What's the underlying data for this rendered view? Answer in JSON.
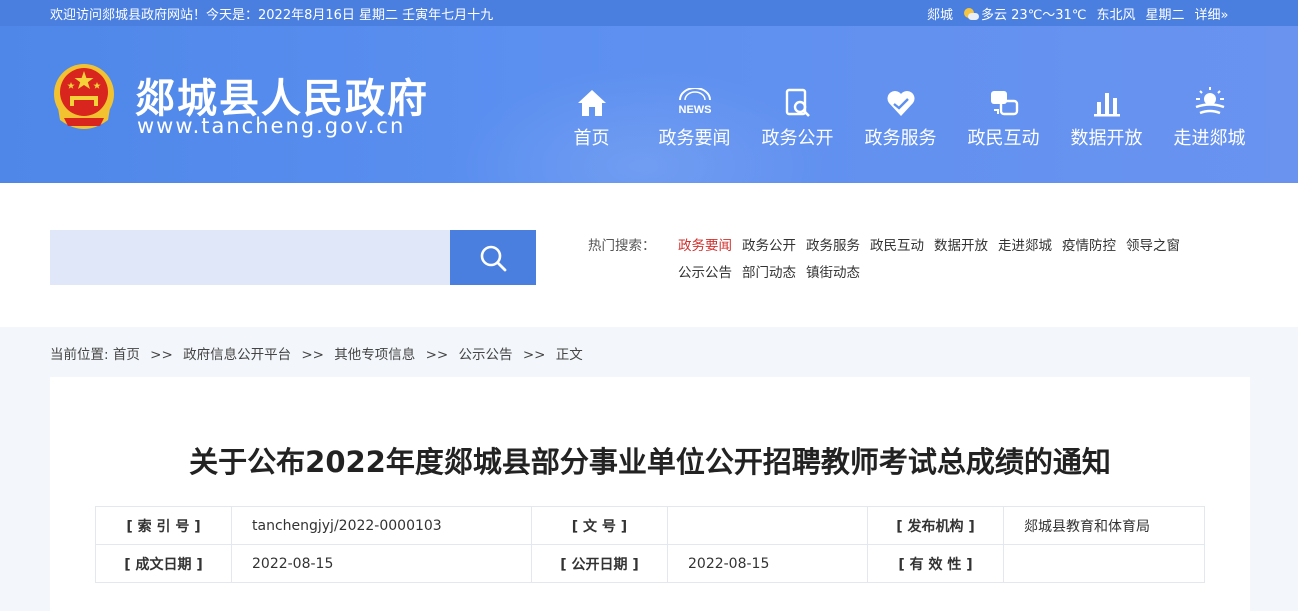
{
  "topbar": {
    "welcome": "欢迎访问郯城县政府网站！今天是：2022年8月16日  星期二  壬寅年七月十九",
    "city": "郯城",
    "weather": "多云 23℃～31℃",
    "wind": "东北风",
    "weekday": "星期二",
    "detail": "详细»"
  },
  "header": {
    "site_name": "郯城县人民政府",
    "site_url": "www.tancheng.gov.cn",
    "nav": [
      {
        "label": "首页",
        "icon": "home-icon"
      },
      {
        "label": "政务要闻",
        "icon": "news-icon"
      },
      {
        "label": "政务公开",
        "icon": "document-search-icon"
      },
      {
        "label": "政务服务",
        "icon": "heart-hands-icon"
      },
      {
        "label": "政民互动",
        "icon": "interaction-icon"
      },
      {
        "label": "数据开放",
        "icon": "bar-chart-icon"
      },
      {
        "label": "走进郯城",
        "icon": "sun-landscape-icon"
      }
    ]
  },
  "search": {
    "placeholder": "",
    "hot_label": "热门搜索：",
    "hot_items": [
      "政务要闻",
      "政务公开",
      "政务服务",
      "政民互动",
      "数据开放",
      "走进郯城",
      "疫情防控",
      "领导之窗",
      "公示公告",
      "部门动态",
      "镇街动态"
    ]
  },
  "breadcrumb": {
    "prefix": "当前位置:",
    "items": [
      "首页",
      "政府信息公开平台",
      "其他专项信息",
      "公示公告",
      "正文"
    ],
    "sep": ">>"
  },
  "article": {
    "title": "关于公布2022年度郯城县部分事业单位公开招聘教师考试总成绩的通知",
    "meta": {
      "index_label": "[ 索  引  号 ]",
      "index_value": "tanchengjyj/2022-0000103",
      "docno_label": "[ 文        号 ]",
      "docno_value": "",
      "issuer_label": "[ 发布机构 ]",
      "issuer_value": "郯城县教育和体育局",
      "created_label": "[ 成文日期 ]",
      "created_value": "2022-08-15",
      "published_label": "[ 公开日期 ]",
      "published_value": "2022-08-15",
      "validity_label": "[ 有  效  性 ]",
      "validity_value": ""
    }
  },
  "colors": {
    "brand_blue": "#4a7fe0",
    "active_red": "#d0312d"
  }
}
